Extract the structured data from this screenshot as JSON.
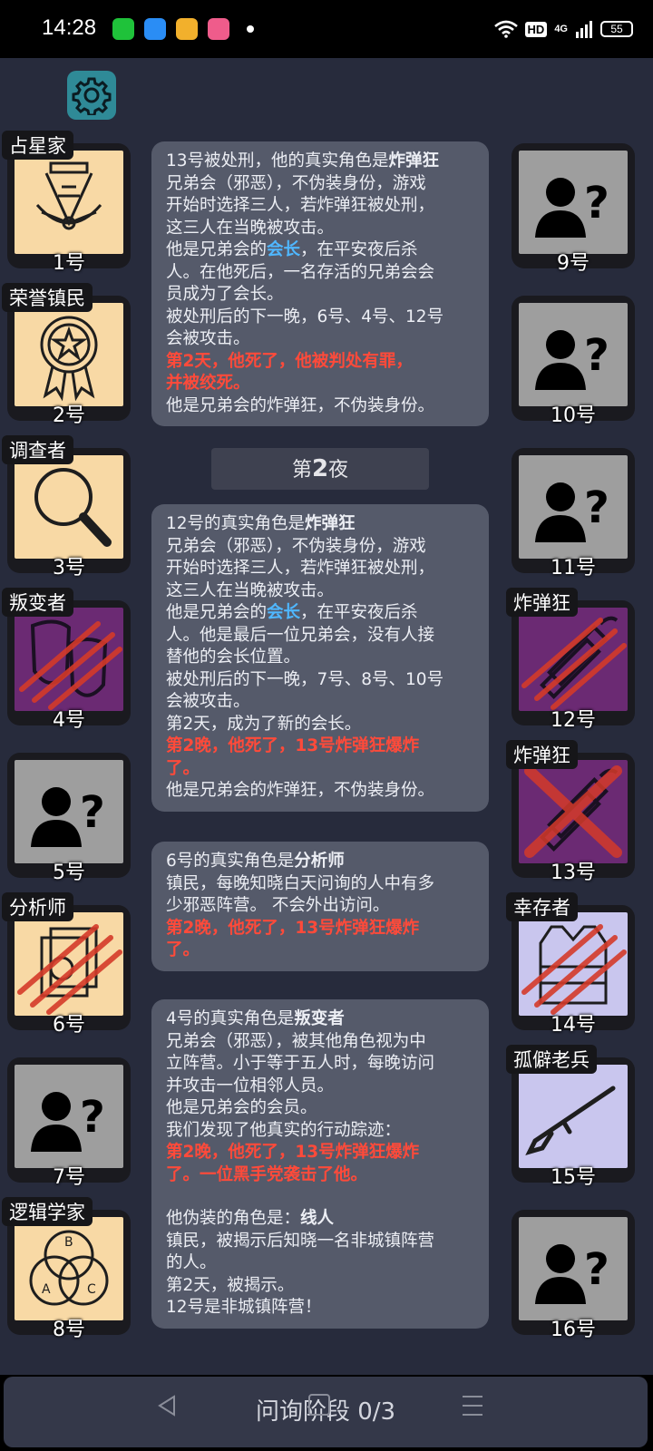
{
  "status_bar": {
    "time": "14:28",
    "network": "4G",
    "hd": "HD",
    "battery": "55"
  },
  "cards_left": [
    {
      "role": "占星家",
      "num": "1号",
      "icon": "sextant-icon",
      "state": "alive",
      "bg": "light"
    },
    {
      "role": "荣誉镇民",
      "num": "2号",
      "icon": "medal-icon",
      "state": "alive",
      "bg": "light"
    },
    {
      "role": "调查者",
      "num": "3号",
      "icon": "magnifier-icon",
      "state": "alive",
      "bg": "light"
    },
    {
      "role": "叛变者",
      "num": "4号",
      "icon": "masks-icon",
      "state": "dead",
      "bg": "purple"
    },
    {
      "role": "",
      "num": "5号",
      "icon": "unknown-person-icon",
      "state": "unknown",
      "bg": "gray"
    },
    {
      "role": "分析师",
      "num": "6号",
      "icon": "documents-icon",
      "state": "dead",
      "bg": "light"
    },
    {
      "role": "",
      "num": "7号",
      "icon": "unknown-person-icon",
      "state": "unknown",
      "bg": "gray"
    },
    {
      "role": "逻辑学家",
      "num": "8号",
      "icon": "venn-icon",
      "state": "alive",
      "bg": "light"
    }
  ],
  "cards_right": [
    {
      "role": "",
      "num": "9号",
      "icon": "unknown-person-icon",
      "state": "unknown",
      "bg": "gray"
    },
    {
      "role": "",
      "num": "10号",
      "icon": "unknown-person-icon",
      "state": "unknown",
      "bg": "gray"
    },
    {
      "role": "",
      "num": "11号",
      "icon": "unknown-person-icon",
      "state": "unknown",
      "bg": "gray"
    },
    {
      "role": "炸弹狂",
      "num": "12号",
      "icon": "dynamite-icon",
      "state": "dead",
      "bg": "purple"
    },
    {
      "role": "炸弹狂",
      "num": "13号",
      "icon": "dynamite-icon",
      "state": "executed",
      "bg": "purple"
    },
    {
      "role": "幸存者",
      "num": "14号",
      "icon": "vest-icon",
      "state": "dead",
      "bg": "lavender"
    },
    {
      "role": "孤僻老兵",
      "num": "15号",
      "icon": "rifle-icon",
      "state": "alive",
      "bg": "lavender"
    },
    {
      "role": "",
      "num": "16号",
      "icon": "unknown-person-icon",
      "state": "unknown",
      "bg": "gray"
    }
  ],
  "log": {
    "entry1": {
      "l1": "13号被处刑，他的真实角色是",
      "l1b": "炸弹狂",
      "l2": "兄弟会（邪恶），不伪装身份，游戏",
      "l3": "开始时选择三人，若炸弹狂被处刑，",
      "l4": "这三人在当晚被攻击。",
      "l5a": "他是兄弟会的",
      "l5b": "会长",
      "l5c": "，在平安夜后杀",
      "l6": "人。在他死后，一名存活的兄弟会会",
      "l7": "员成为了会长。",
      "l8": "被处刑后的下一晚，6号、4号、12号",
      "l9": "会被攻击。",
      "l10": "第2天，他死了，他被判处有罪，",
      "l11": "并被绞死。",
      "l12": "他是兄弟会的炸弹狂，不伪装身份。"
    },
    "night_a": "第",
    "night_num": "2",
    "night_b": "夜",
    "entry2": {
      "l1": "12号的真实角色是",
      "l1b": "炸弹狂",
      "l2": "兄弟会（邪恶），不伪装身份，游戏",
      "l3": "开始时选择三人，若炸弹狂被处刑，",
      "l4": "这三人在当晚被攻击。",
      "l5a": "他是兄弟会的",
      "l5b": "会长",
      "l5c": "，在平安夜后杀",
      "l6": "人。他是最后一位兄弟会，没有人接",
      "l7": "替他的会长位置。",
      "l8": "被处刑后的下一晚，7号、8号、10号",
      "l9": "会被攻击。",
      "l10": "第2天，成为了新的会长。",
      "l11": "第2晚，他死了，13号炸弹狂爆炸",
      "l12": "了。",
      "l13": "他是兄弟会的炸弹狂，不伪装身份。"
    },
    "entry3": {
      "l1": "6号的真实角色是",
      "l1b": "分析师",
      "l2": "镇民，每晚知晓白天问询的人中有多",
      "l3": "少邪恶阵营。 不会外出访问。",
      "l4": "第2晚，他死了，13号炸弹狂爆炸",
      "l5": "了。"
    },
    "entry4": {
      "l1": "4号的真实角色是",
      "l1b": "叛变者",
      "l2": "兄弟会（邪恶），被其他角色视为中",
      "l3": "立阵营。小于等于五人时，每晚访问",
      "l4": "并攻击一位相邻人员。",
      "l5": "他是兄弟会的会员。",
      "l6": "我们发现了他真实的行动踪迹：",
      "l7": "第2晚，他死了，13号炸弹狂爆炸",
      "l8": "了。一位黑手党袭击了他。",
      "l9a": "他伪装的角色是：",
      "l9b": "线人",
      "l10": "镇民，被揭示后知晓一名非城镇阵营",
      "l11": "的人。",
      "l12": "第2天，被揭示。",
      "l13": "12号是非城镇阵营！"
    }
  },
  "bottom_button": "问询阶段 0/3",
  "colors": {
    "app_bg": "#272b3c",
    "entry_bg": "#555a6a",
    "death_text": "#ff4a3a",
    "highlight": "#4fb7ff",
    "settings_btn": "#2f8a97"
  }
}
